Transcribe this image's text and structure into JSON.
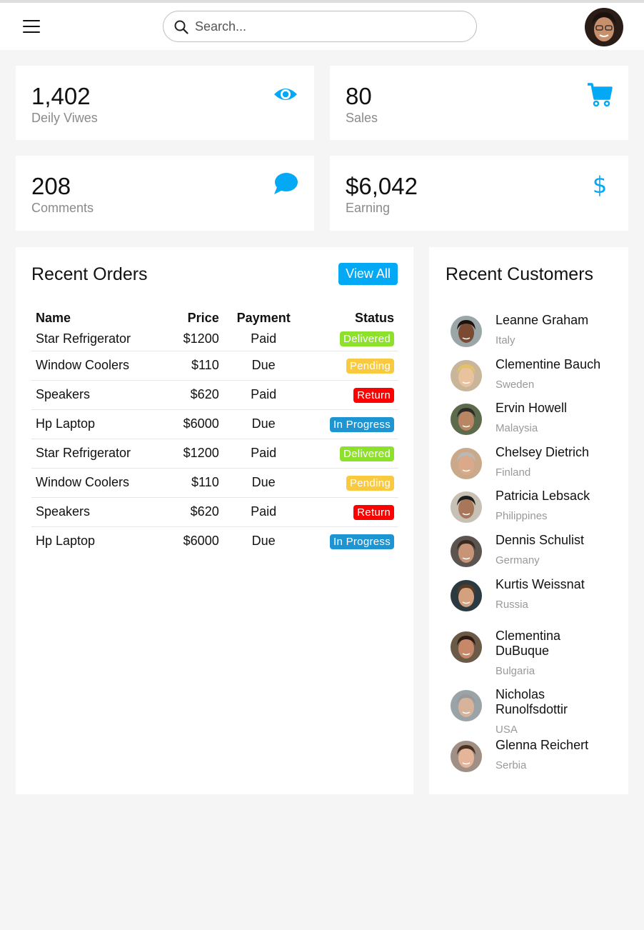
{
  "search": {
    "placeholder": "Search..."
  },
  "stats": [
    {
      "value": "1,402",
      "label": "Deily Viwes",
      "icon": "eye-icon"
    },
    {
      "value": "80",
      "label": "Sales",
      "icon": "cart-icon"
    },
    {
      "value": "208",
      "label": "Comments",
      "icon": "chat-icon"
    },
    {
      "value": "$6,042",
      "label": "Earning",
      "icon": "dollar-icon"
    }
  ],
  "accent": "#03a9f4",
  "orders": {
    "title": "Recent Orders",
    "view_all": "View All",
    "columns": [
      "Name",
      "Price",
      "Payment",
      "Status"
    ],
    "rows": [
      {
        "name": "Star Refrigerator",
        "price": "$1200",
        "payment": "Paid",
        "status": "Delivered"
      },
      {
        "name": "Window Coolers",
        "price": "$110",
        "payment": "Due",
        "status": "Pending"
      },
      {
        "name": "Speakers",
        "price": "$620",
        "payment": "Paid",
        "status": "Return"
      },
      {
        "name": "Hp Laptop",
        "price": "$6000",
        "payment": "Due",
        "status": "In Progress"
      },
      {
        "name": "Star Refrigerator",
        "price": "$1200",
        "payment": "Paid",
        "status": "Delivered"
      },
      {
        "name": "Window Coolers",
        "price": "$110",
        "payment": "Due",
        "status": "Pending"
      },
      {
        "name": "Speakers",
        "price": "$620",
        "payment": "Paid",
        "status": "Return"
      },
      {
        "name": "Hp Laptop",
        "price": "$6000",
        "payment": "Due",
        "status": "In Progress"
      }
    ],
    "status_colors": {
      "Delivered": "#8de02c",
      "Pending": "#f9ca3f",
      "Return": "#f00",
      "In Progress": "#1e95d3"
    }
  },
  "customers": {
    "title": "Recent Customers",
    "items": [
      {
        "name": "Leanne Graham",
        "country": "Italy"
      },
      {
        "name": "Clementine Bauch",
        "country": "Sweden"
      },
      {
        "name": "Ervin Howell",
        "country": "Malaysia"
      },
      {
        "name": "Chelsey Dietrich",
        "country": "Finland"
      },
      {
        "name": "Patricia Lebsack",
        "country": "Philippines"
      },
      {
        "name": "Dennis Schulist",
        "country": "Germany"
      },
      {
        "name": "Kurtis Weissnat",
        "country": "Russia"
      },
      {
        "name": "Clementina DuBuque",
        "country": "Bulgaria"
      },
      {
        "name": "Nicholas Runolfsdottir",
        "country": "USA"
      },
      {
        "name": "Glenna Reichert",
        "country": "Serbia"
      }
    ]
  }
}
